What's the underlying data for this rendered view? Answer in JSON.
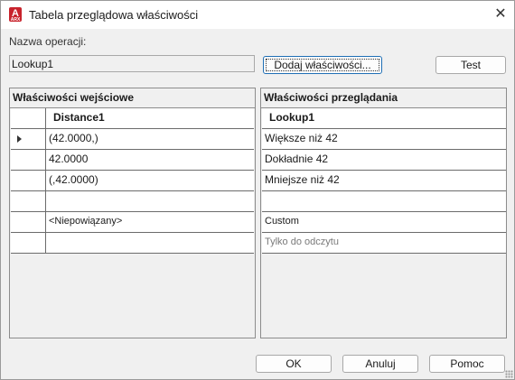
{
  "window": {
    "title": "Tabela przeglądowa właściwości",
    "close_icon": "close-icon",
    "app_icon_letter": "A",
    "app_icon_text": "ARX"
  },
  "operation": {
    "label": "Nazwa operacji:",
    "value": "Lookup1"
  },
  "buttons": {
    "add_properties": "Dodaj właściwości...",
    "test": "Test",
    "ok": "OK",
    "cancel": "Anuluj",
    "help": "Pomoc"
  },
  "input_properties": {
    "header": "Właściwości wejściowe",
    "column": "Distance1",
    "rows": [
      "(42.0000,)",
      "42.0000",
      "(,42.0000)",
      "",
      "<Niepowiązany>",
      ""
    ]
  },
  "lookup_properties": {
    "header": "Właściwości przeglądania",
    "column": "Lookup1",
    "rows": [
      "Większe niż 42",
      "Dokładnie 42",
      "Mniejsze niż 42",
      "",
      "Custom",
      "Tylko do odczytu"
    ]
  },
  "colors": {
    "accent": "#1f6fb5",
    "app_icon": "#c8232c"
  }
}
